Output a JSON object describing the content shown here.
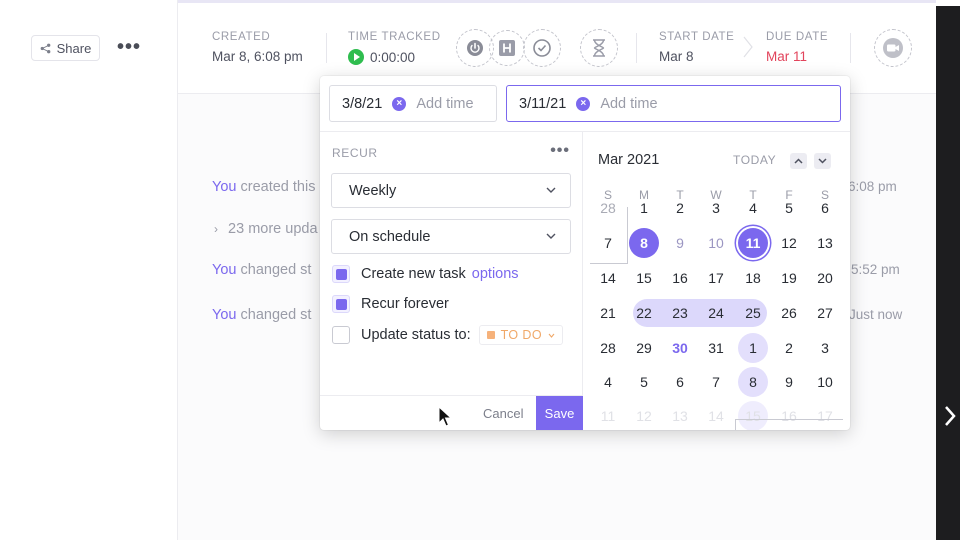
{
  "share": {
    "label": "Share"
  },
  "header": {
    "created": {
      "label": "CREATED",
      "value": "Mar 8, 6:08 pm"
    },
    "time_tracked": {
      "label": "TIME TRACKED",
      "value": "0:00:00"
    },
    "start_date": {
      "label": "START DATE",
      "value": "Mar 8"
    },
    "due_date": {
      "label": "DUE DATE",
      "value": "Mar 11"
    },
    "due_color": "#e2445c"
  },
  "activity": [
    {
      "who": "You",
      "text": "created this",
      "time": "6:08 pm"
    },
    {
      "who": "",
      "text": "23 more upda",
      "time": ""
    },
    {
      "who": "You",
      "text": "changed st",
      "time": "5:52 pm"
    },
    {
      "who": "You",
      "text": "changed st",
      "time": "Just now"
    }
  ],
  "popup": {
    "start": {
      "value": "3/8/21",
      "add_time": "Add time"
    },
    "due": {
      "value": "3/11/21",
      "add_time": "Add time"
    },
    "recur": {
      "label": "RECUR",
      "frequency": "Weekly",
      "schedule": "On schedule",
      "create_new_task": {
        "label": "Create new task",
        "options": "options",
        "checked": true
      },
      "recur_forever": {
        "label": "Recur forever",
        "checked": true
      },
      "update_status": {
        "label": "Update status to:",
        "status": "TO DO",
        "checked": false,
        "status_color": "#f6b27b"
      }
    },
    "cancel_label": "Cancel",
    "save_label": "Save",
    "accent_color": "#7b68ee"
  },
  "calendar": {
    "month": "Mar 2021",
    "today_label": "TODAY",
    "weekdays": [
      "S",
      "M",
      "T",
      "W",
      "T",
      "F",
      "S"
    ],
    "weeks": [
      [
        "28",
        "1",
        "2",
        "3",
        "4",
        "5",
        "6"
      ],
      [
        "7",
        "8",
        "9",
        "10",
        "11",
        "12",
        "13"
      ],
      [
        "14",
        "15",
        "16",
        "17",
        "18",
        "19",
        "20"
      ],
      [
        "21",
        "22",
        "23",
        "24",
        "25",
        "26",
        "27"
      ],
      [
        "28",
        "29",
        "30",
        "31",
        "1",
        "2",
        "3"
      ],
      [
        "4",
        "5",
        "6",
        "7",
        "8",
        "9",
        "10"
      ],
      [
        "11",
        "12",
        "13",
        "14",
        "15",
        "16",
        "17"
      ]
    ],
    "range_start": "8",
    "range_end": "11",
    "today": "30",
    "recurring_days": [
      "1",
      "8",
      "15"
    ]
  }
}
